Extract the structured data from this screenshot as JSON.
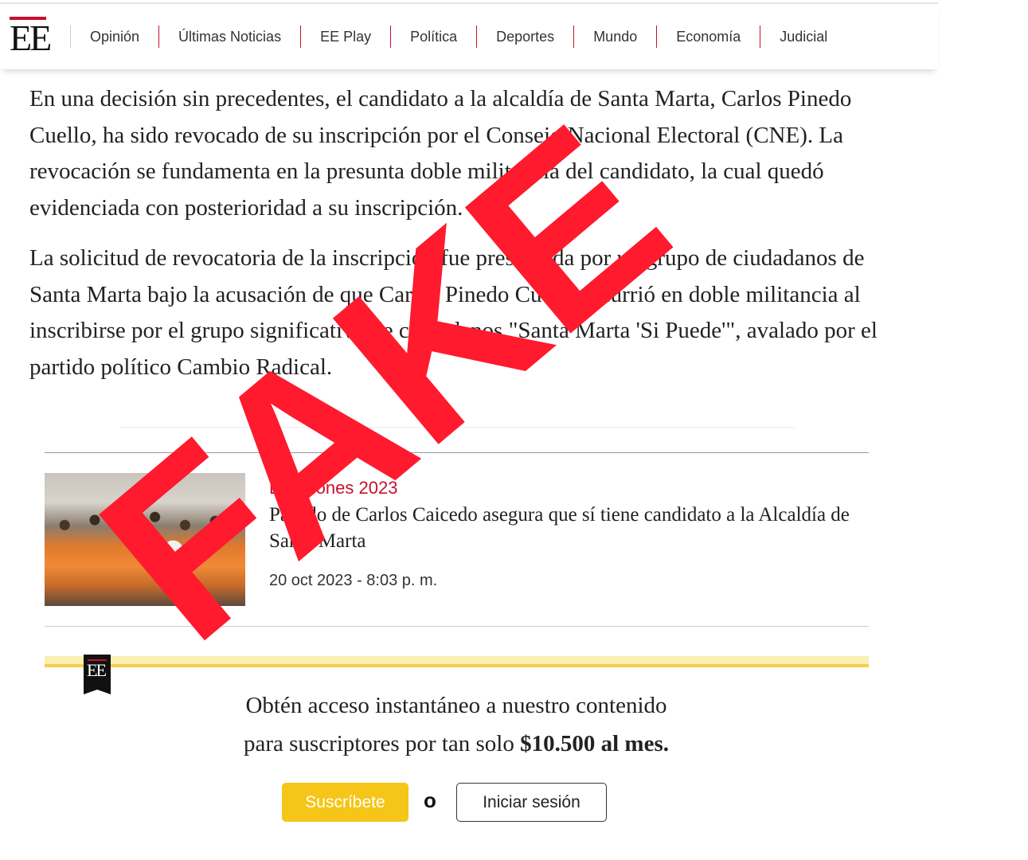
{
  "header": {
    "logo_text": "EE",
    "nav": [
      "Opinión",
      "Últimas Noticias",
      "EE Play",
      "Política",
      "Deportes",
      "Mundo",
      "Economía",
      "Judicial"
    ]
  },
  "article": {
    "paragraphs": [
      "En una decisión sin precedentes, el candidato a la alcaldía de Santa Marta, Carlos Pinedo Cuello, ha sido revocado de su inscripción por el Consejo Nacional Electoral (CNE). La revocación se fundamenta en la presunta doble militancia del candidato, la cual quedó evidenciada con posterioridad a su inscripción.",
      "La solicitud de revocatoria de la inscripción fue presentada por un grupo de ciudadanos de Santa Marta bajo la acusación de que Carlos Pinedo Cuello incurrió en doble militancia al inscribirse por el grupo significativo de ciudadanos \"Santa Marta 'Si Puede'\", avalado por el partido político Cambio Radical."
    ]
  },
  "related": {
    "kicker": "Elecciones 2023",
    "title": "Partido de Carlos Caicedo asegura que sí tiene candidato a la Alcaldía de Santa Marta",
    "date": "20 oct 2023 - 8:03 p. m."
  },
  "paywall": {
    "badge_text": "EE",
    "line1": "Obtén acceso instantáneo a nuestro contenido",
    "line2_prefix": "para suscriptores por tan solo ",
    "line2_price": "$10.500 al mes.",
    "subscribe_label": "Suscríbete",
    "or_label": "o",
    "login_label": "Iniciar sesión"
  },
  "overlay": {
    "stamp_text": "FAKE",
    "stamp_color": "#ff1a2e"
  },
  "colors": {
    "brand_red": "#c8102e",
    "gold": "#f5c518"
  }
}
